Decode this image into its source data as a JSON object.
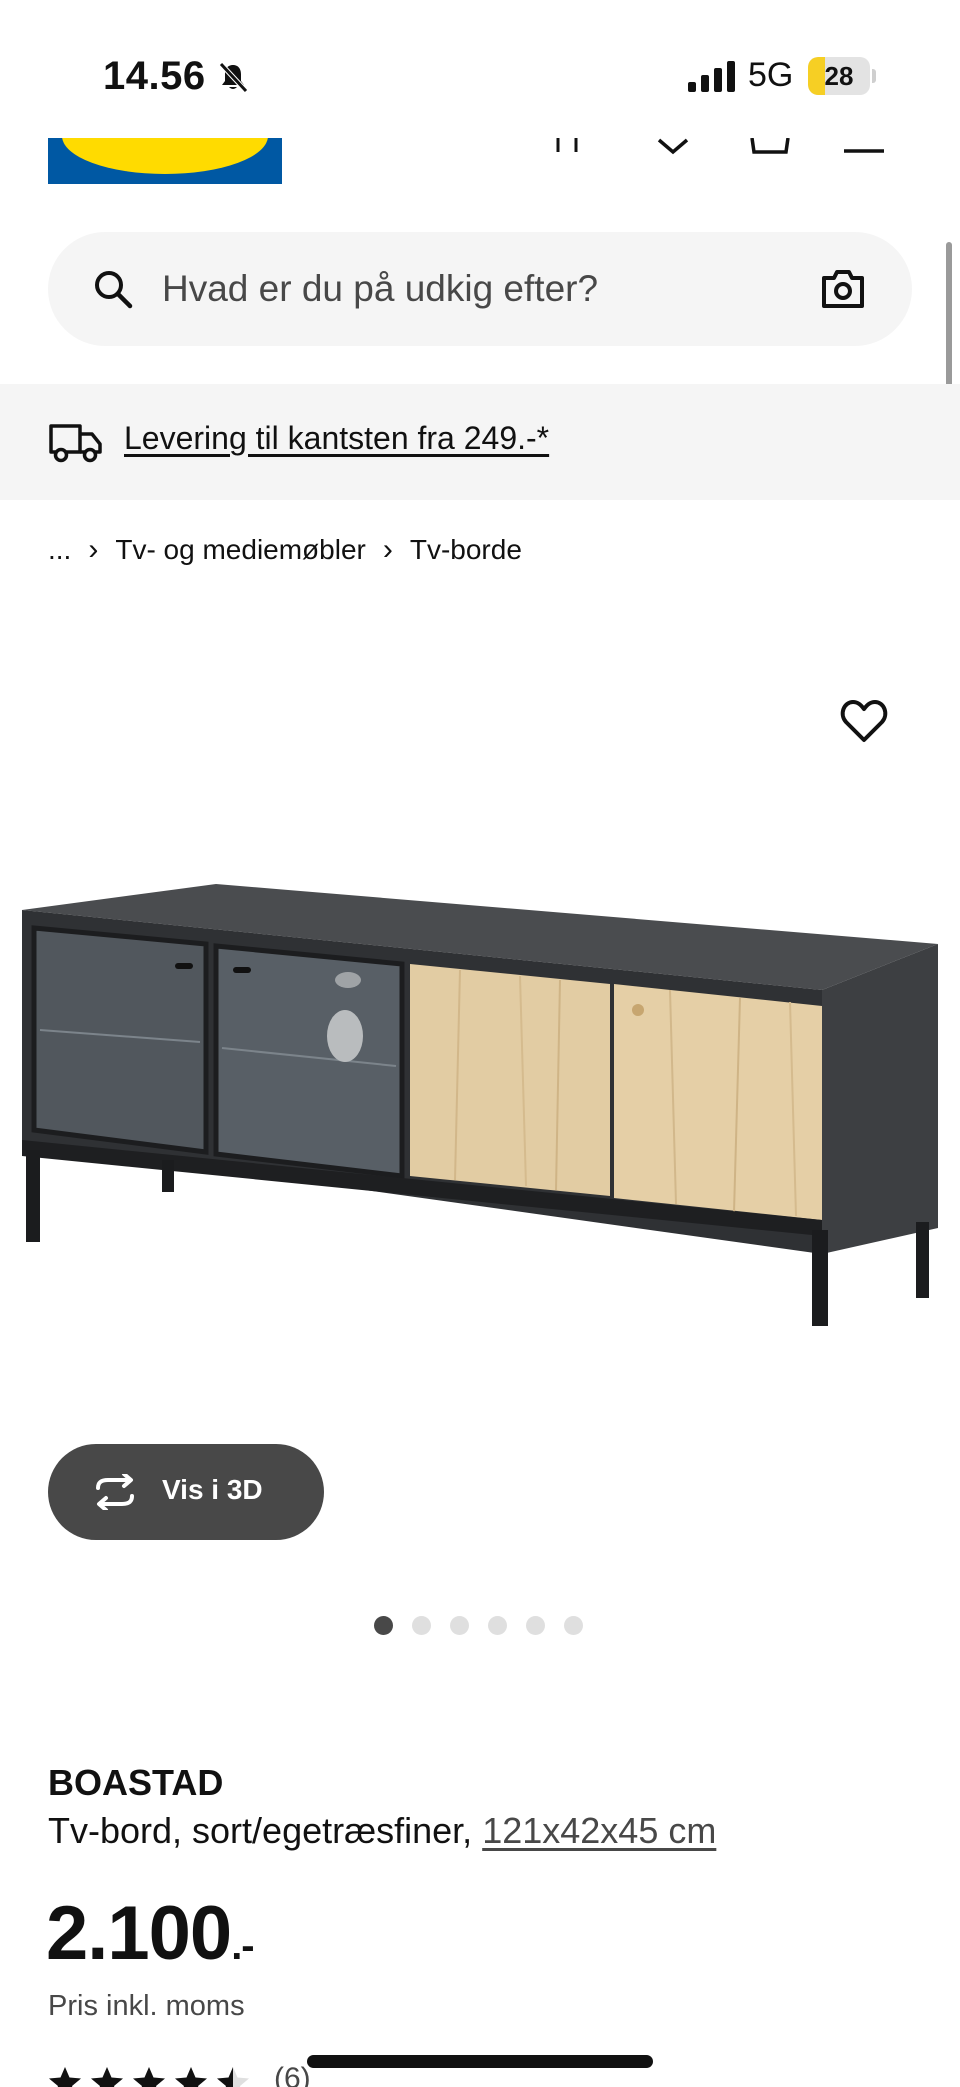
{
  "status_bar": {
    "time": "14.56",
    "network": "5G",
    "battery": {
      "level": 28,
      "label": "28"
    }
  },
  "search": {
    "placeholder": "Hvad er du på udkig efter?"
  },
  "delivery": {
    "text": "Levering til kantsten fra 249.-*"
  },
  "breadcrumb": {
    "ellipsis": "...",
    "separator": "›",
    "items": [
      "Tv- og mediemøbler",
      "Tv-borde"
    ]
  },
  "gallery": {
    "view_3d_label": "Vis i 3D",
    "image_count": 6,
    "active_index": 0
  },
  "product": {
    "name": "BOASTAD",
    "description": "Tv-bord, sort/egetræsfiner,",
    "dimensions": "121x42x45 cm",
    "price_main": "2.100",
    "price_suffix": ".-",
    "price_note": "Pris inkl. moms",
    "rating": {
      "stars": 4.5,
      "max": 5,
      "count_label": "(6)"
    }
  },
  "colors": {
    "ikea_blue": "#0058a3",
    "ikea_yellow": "#ffdb00",
    "button_dark": "#484848",
    "battery_yellow": "#f6cf24"
  },
  "icons": {
    "bell": "bell-slash-icon",
    "search": "search-icon",
    "camera": "camera-icon",
    "truck": "truck-icon",
    "heart": "heart-icon",
    "rotate": "rotate-3d-icon"
  }
}
